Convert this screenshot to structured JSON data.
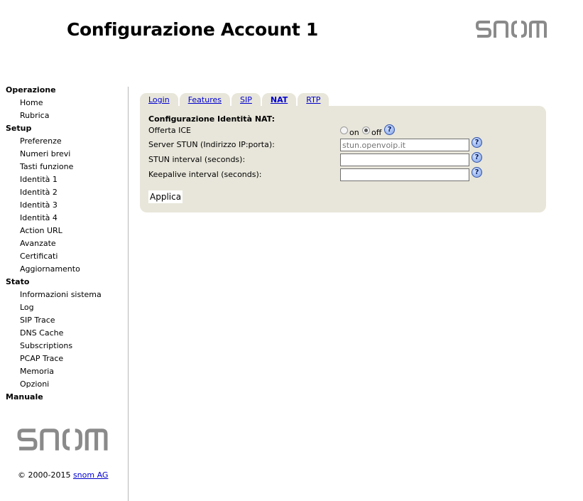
{
  "header": {
    "title": "Configurazione Account 1",
    "logo_text": "snom"
  },
  "sidebar": {
    "sections": [
      {
        "label": "Operazione",
        "items": [
          "Home",
          "Rubrica"
        ]
      },
      {
        "label": "Setup",
        "items": [
          "Preferenze",
          "Numeri brevi",
          "Tasti funzione",
          "Identità 1",
          "Identità 2",
          "Identità 3",
          "Identità 4",
          "Action URL",
          "Avanzate",
          "Certificati",
          "Aggiornamento"
        ]
      },
      {
        "label": "Stato",
        "items": [
          "Informazioni sistema",
          "Log",
          "SIP Trace",
          "DNS Cache",
          "Subscriptions",
          "PCAP Trace",
          "Memoria",
          "Opzioni"
        ]
      },
      {
        "label": "Manuale",
        "items": []
      }
    ]
  },
  "footer": {
    "copyright": "© 2000-2015 ",
    "company_link": "snom AG"
  },
  "tabs": [
    {
      "label": "Login",
      "active": false
    },
    {
      "label": "Features",
      "active": false
    },
    {
      "label": "SIP",
      "active": false
    },
    {
      "label": "NAT",
      "active": true
    },
    {
      "label": "RTP",
      "active": false
    }
  ],
  "form": {
    "section_title": "Configurazione Identità NAT:",
    "ice": {
      "label": "Offerta ICE",
      "options": [
        "on",
        "off"
      ],
      "selected": "off"
    },
    "stun_server": {
      "label": "Server STUN (Indirizzo IP:porta):",
      "placeholder": "stun.openvoip.it",
      "value": ""
    },
    "stun_interval": {
      "label": "STUN interval (seconds):",
      "value": ""
    },
    "keepalive_interval": {
      "label": "Keepalive interval (seconds):",
      "value": ""
    },
    "help_symbol": "?",
    "apply_label": "Applica"
  }
}
